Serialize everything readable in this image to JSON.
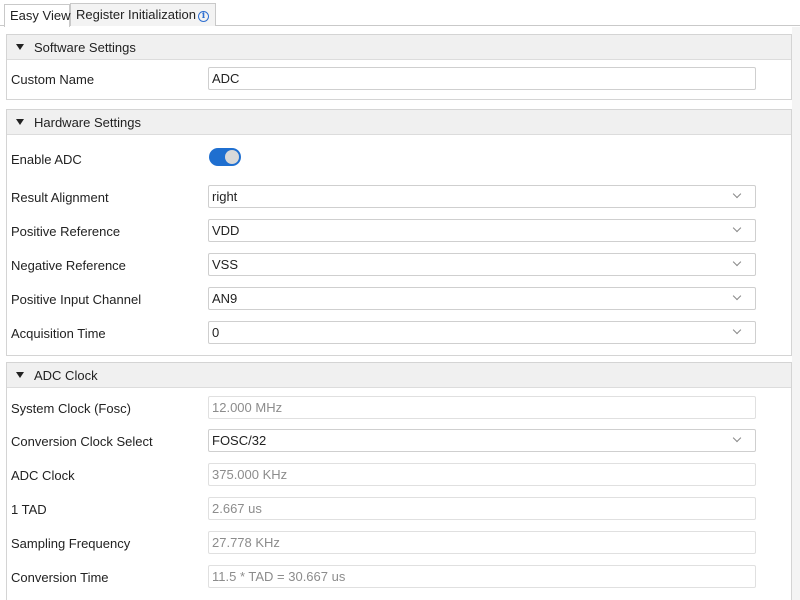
{
  "tabs": [
    {
      "label": "Easy View",
      "active": true
    },
    {
      "label": "Register Initialization",
      "active": false,
      "icon": "info-icon"
    }
  ],
  "software_settings": {
    "title": "Software Settings",
    "custom_name": {
      "label": "Custom Name",
      "value": "ADC"
    }
  },
  "hardware_settings": {
    "title": "Hardware Settings",
    "enable_adc": {
      "label": "Enable ADC",
      "on": true
    },
    "result_alignment": {
      "label": "Result Alignment",
      "value": "right"
    },
    "positive_reference": {
      "label": "Positive Reference",
      "value": "VDD"
    },
    "negative_reference": {
      "label": "Negative Reference",
      "value": "VSS"
    },
    "positive_input_channel": {
      "label": "Positive Input Channel",
      "value": "AN9"
    },
    "acquisition_time": {
      "label": "Acquisition Time",
      "value": "0"
    }
  },
  "adc_clock": {
    "title": "ADC Clock",
    "system_clock": {
      "label": "System Clock (Fosc)",
      "value": "12.000 MHz"
    },
    "conversion_clock_select": {
      "label": "Conversion Clock Select",
      "value": "FOSC/32"
    },
    "adc_clock": {
      "label": "ADC Clock",
      "value": "375.000 KHz"
    },
    "tad": {
      "label": "1 TAD",
      "value": "2.667 us"
    },
    "sampling_frequency": {
      "label": "Sampling Frequency",
      "value": "27.778 KHz"
    },
    "conversion_time": {
      "label": "Conversion Time",
      "value": "11.5 * TAD = 30.667 us"
    }
  },
  "colors": {
    "accent": "#1f6fd0",
    "header_bg": "#f0f0f0",
    "readonly_text": "#8c8c8c"
  }
}
